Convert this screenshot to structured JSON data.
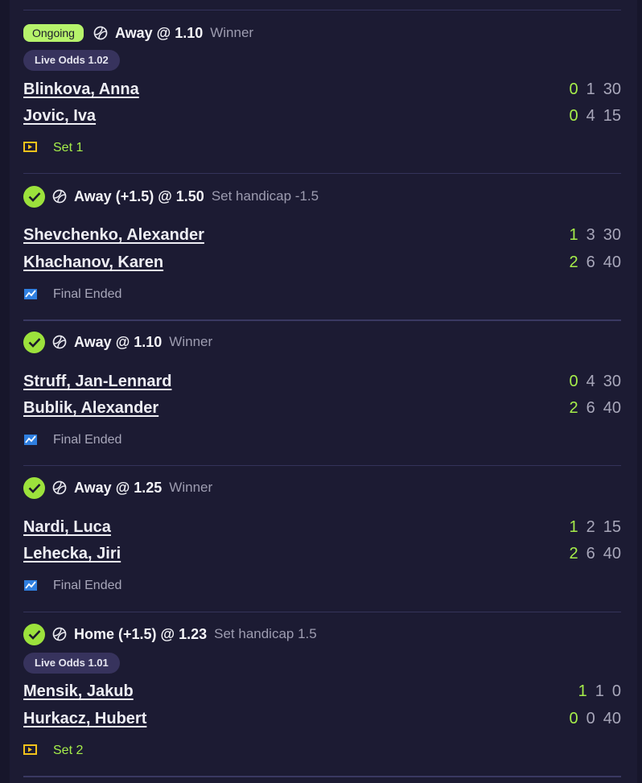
{
  "colors": {
    "accent_green": "#a6ee4a",
    "panel_bg": "#1c1b33",
    "page_bg": "#17162b",
    "badge_bg": "#37335d"
  },
  "bets": [
    {
      "state": "Ongoing",
      "bet": "Away @ 1.10",
      "market": "Winner",
      "live_odds": "Live Odds 1.02",
      "players": [
        {
          "name": "Blinkova, Anna",
          "sets": "0",
          "games": "1",
          "points": "30"
        },
        {
          "name": "Jovic, Iva",
          "sets": "0",
          "games": "4",
          "points": "15"
        }
      ],
      "status_icon": "live-set-icon",
      "status": "Set 1"
    },
    {
      "state": "won",
      "bet": "Away (+1.5) @ 1.50",
      "market": "Set handicap -1.5",
      "players": [
        {
          "name": "Shevchenko, Alexander",
          "sets": "1",
          "games": "3",
          "points": "30"
        },
        {
          "name": "Khachanov, Karen",
          "sets": "2",
          "games": "6",
          "points": "40"
        }
      ],
      "status_icon": "chart-icon",
      "status": "Final Ended"
    },
    {
      "state": "won",
      "bet": "Away @ 1.10",
      "market": "Winner",
      "players": [
        {
          "name": "Struff, Jan-Lennard",
          "sets": "0",
          "games": "4",
          "points": "30"
        },
        {
          "name": "Bublik, Alexander",
          "sets": "2",
          "games": "6",
          "points": "40"
        }
      ],
      "status_icon": "chart-icon",
      "status": "Final Ended"
    },
    {
      "state": "won",
      "bet": "Away @ 1.25",
      "market": "Winner",
      "players": [
        {
          "name": "Nardi, Luca",
          "sets": "1",
          "games": "2",
          "points": "15"
        },
        {
          "name": "Lehecka, Jiri",
          "sets": "2",
          "games": "6",
          "points": "40"
        }
      ],
      "status_icon": "chart-icon",
      "status": "Final Ended"
    },
    {
      "state": "won",
      "bet": "Home (+1.5) @ 1.23",
      "market": "Set handicap 1.5",
      "live_odds": "Live Odds 1.01",
      "players": [
        {
          "name": "Mensik, Jakub",
          "sets": "1",
          "games": "1",
          "points": "0"
        },
        {
          "name": "Hurkacz, Hubert",
          "sets": "0",
          "games": "0",
          "points": "40"
        }
      ],
      "status_icon": "live-set-icon",
      "status": "Set 2"
    }
  ]
}
